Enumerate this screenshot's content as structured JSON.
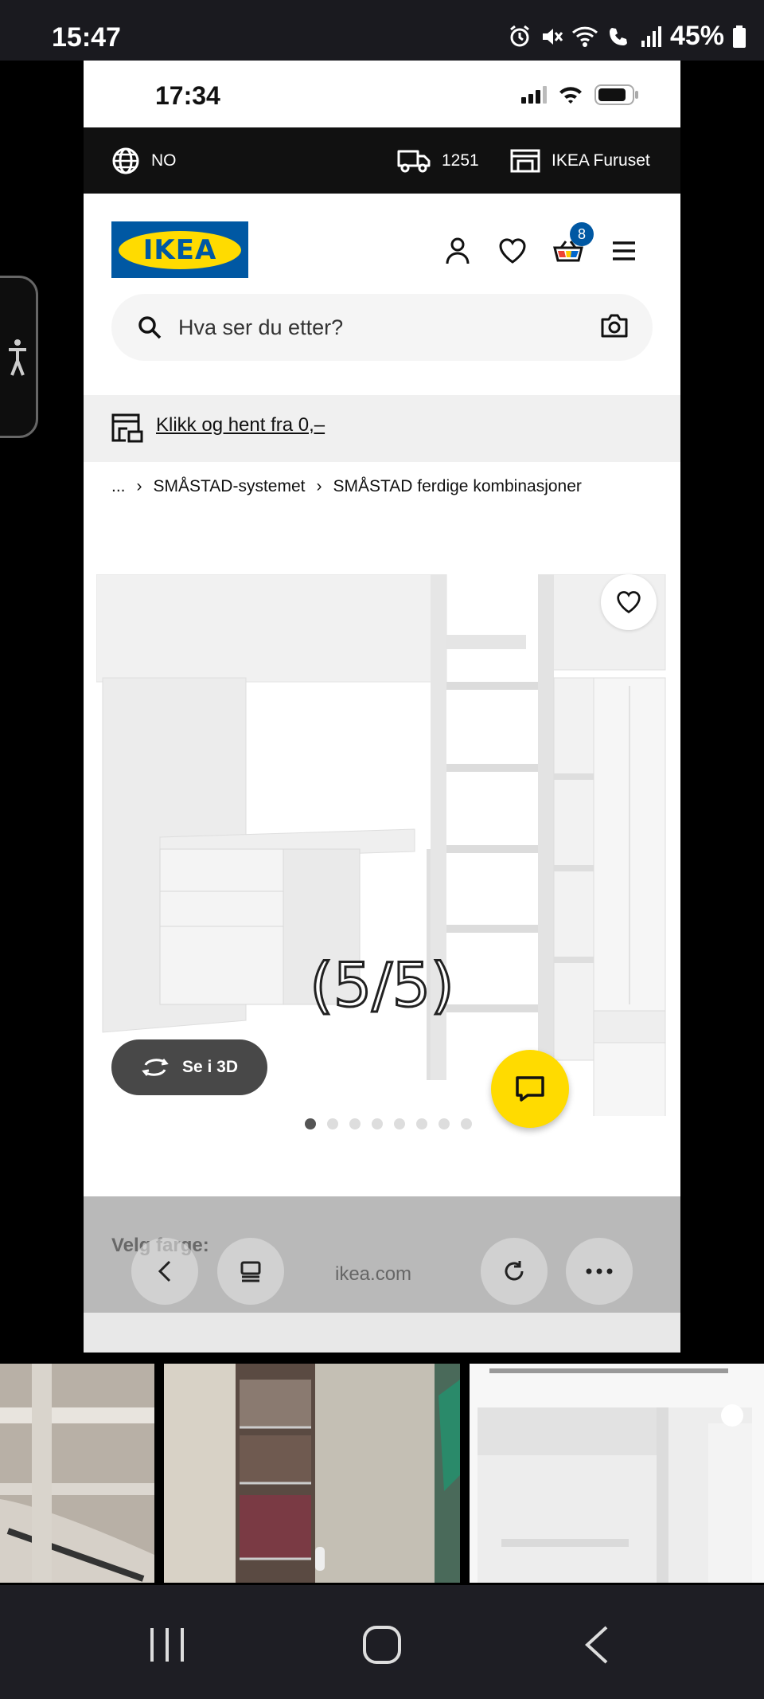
{
  "android_status": {
    "time": "15:47",
    "battery": "45%"
  },
  "ios_status": {
    "time": "17:34"
  },
  "topbar": {
    "language": "NO",
    "delivery_code": "1251",
    "store": "IKEA Furuset"
  },
  "header": {
    "logo_text": "IKEA",
    "cart_count": "8"
  },
  "search": {
    "placeholder": "Hva ser du etter?"
  },
  "promo": {
    "text": "Klikk og hent fra 0,–"
  },
  "breadcrumb": {
    "ellipsis": "...",
    "items": [
      "SMÅSTAD-systemet",
      "SMÅSTAD ferdige kombinasjoner"
    ]
  },
  "product": {
    "view_3d_label": "Se i 3D",
    "gallery_total": 8,
    "gallery_active": 1
  },
  "variant": {
    "text": "Velg farge:"
  },
  "browser": {
    "url": "ikea.com"
  },
  "viewer": {
    "counter": "(5/5)"
  },
  "colors": {
    "ikea_blue": "#0058a3",
    "ikea_yellow": "#ffdb00"
  }
}
